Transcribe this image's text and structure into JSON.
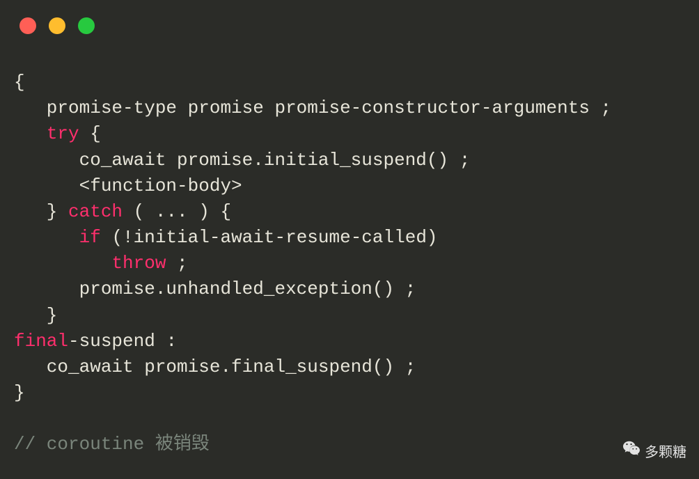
{
  "code": {
    "tokens": [
      [
        {
          "c": "p",
          "t": "{"
        }
      ],
      [
        {
          "c": "p",
          "t": "   promise-type promise promise-constructor-arguments ;"
        }
      ],
      [
        {
          "c": "p",
          "t": "   "
        },
        {
          "c": "kw",
          "t": "try"
        },
        {
          "c": "p",
          "t": " {"
        }
      ],
      [
        {
          "c": "p",
          "t": "      co_await promise.initial_suspend() ;"
        }
      ],
      [
        {
          "c": "p",
          "t": "      <function-body>"
        }
      ],
      [
        {
          "c": "p",
          "t": "   } "
        },
        {
          "c": "kw",
          "t": "catch"
        },
        {
          "c": "p",
          "t": " ( ... ) {"
        }
      ],
      [
        {
          "c": "p",
          "t": "      "
        },
        {
          "c": "kw",
          "t": "if"
        },
        {
          "c": "p",
          "t": " (!initial-await-resume-called)"
        }
      ],
      [
        {
          "c": "p",
          "t": "         "
        },
        {
          "c": "kw",
          "t": "throw"
        },
        {
          "c": "p",
          "t": " ;"
        }
      ],
      [
        {
          "c": "p",
          "t": "      promise.unhandled_exception() ;"
        }
      ],
      [
        {
          "c": "p",
          "t": "   }"
        }
      ],
      [
        {
          "c": "kw",
          "t": "final"
        },
        {
          "c": "p",
          "t": "-suspend :"
        }
      ],
      [
        {
          "c": "p",
          "t": "   co_await promise.final_suspend() ;"
        }
      ],
      [
        {
          "c": "p",
          "t": "}"
        }
      ],
      [
        {
          "c": "p",
          "t": ""
        }
      ],
      [
        {
          "c": "cm",
          "t": "// coroutine 被销毁"
        }
      ]
    ]
  },
  "watermark": {
    "text": "多颗糖",
    "icon": "wechat-icon"
  }
}
